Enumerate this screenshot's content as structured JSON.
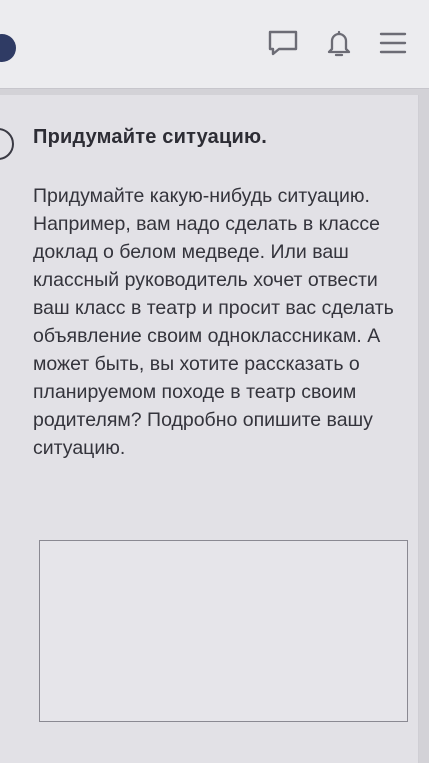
{
  "header": {
    "icons": [
      "chat-icon",
      "bell-icon",
      "menu-icon"
    ]
  },
  "task": {
    "title": "Придумайте ситуацию.",
    "body": "Придумайте какую-нибудь ситуацию. Например, вам надо сделать в классе доклад о белом медведе. Или ваш классный руководитель хочет отвести ваш класс в театр и просит вас сделать объявление своим одноклассникам. А может быть, вы хотите рассказать о планируемом походе в театр своим родителям? Подробно опишите вашу ситуацию.",
    "answer_value": ""
  },
  "colors": {
    "header_bg": "#ececef",
    "page_bg": "#e2e1e6",
    "icon": "#6c6c75",
    "text": "#2c2c33"
  }
}
